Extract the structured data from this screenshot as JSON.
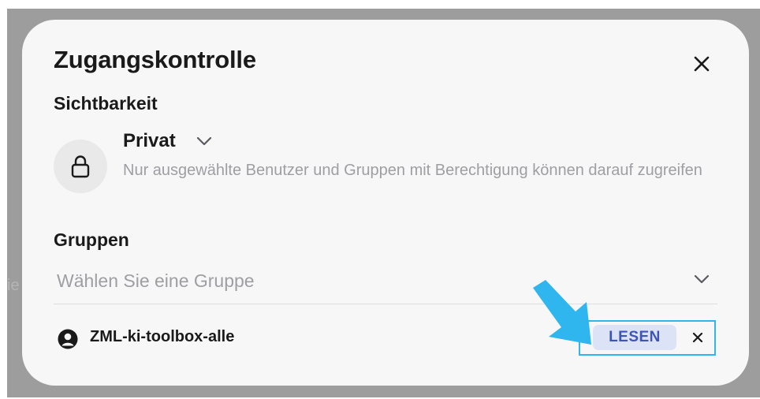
{
  "backdrop": {
    "ghost_text": "ie"
  },
  "dialog": {
    "title": "Zugangskontrolle",
    "close_icon": "close-icon"
  },
  "visibility": {
    "label": "Sichtbarkeit",
    "icon": "lock-icon",
    "selected": "Privat",
    "description": "Nur ausgewählte Benutzer und Gruppen mit Berechtigung können darauf zugreifen"
  },
  "groups": {
    "label": "Gruppen",
    "placeholder": "Wählen Sie eine Gruppe",
    "items": [
      {
        "icon": "user-circle-icon",
        "name": "ZML-ki-toolbox-alle",
        "permission": "LESEN"
      }
    ]
  },
  "annotation": {
    "arrow_color": "#2fb6ef",
    "highlight_color": "#2fb6ef"
  },
  "colors": {
    "backdrop": "#9d9d9d",
    "dialog_bg": "#f7f7f8",
    "badge_bg": "#dde3f6",
    "badge_text": "#3d55b8",
    "muted_text": "#9e9ea3"
  }
}
